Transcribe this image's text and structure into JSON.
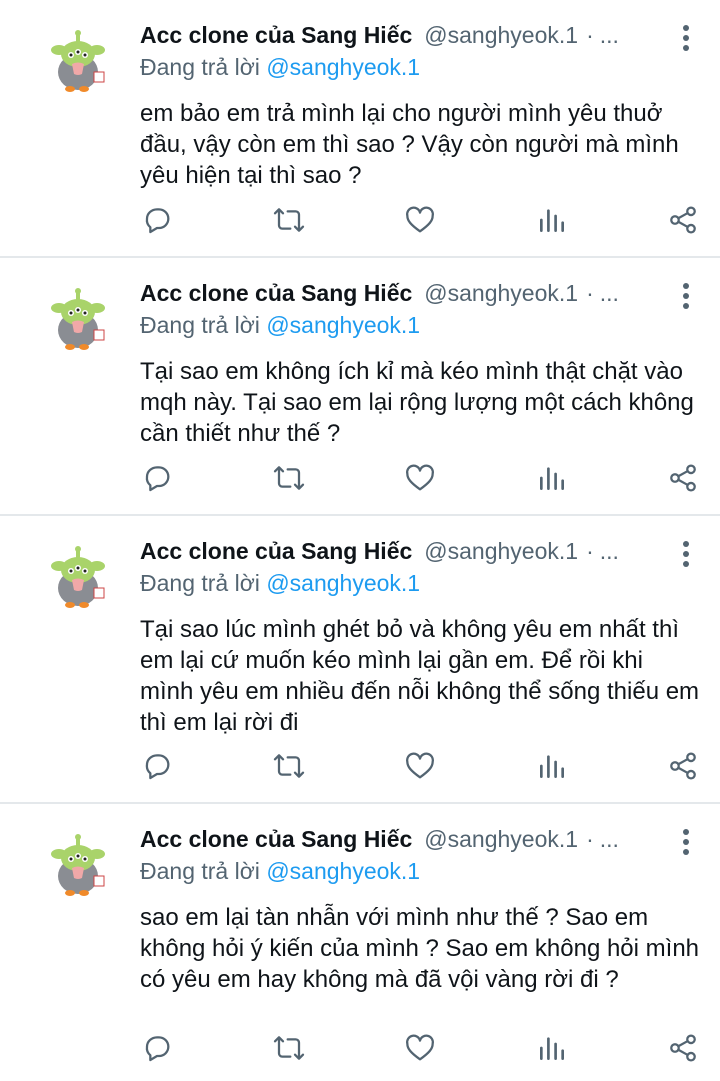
{
  "tweets": [
    {
      "author_name": "Acc clone của Sang Hiếc",
      "handle": "@sanghyeok.1",
      "sep": "·",
      "truncation": "...",
      "reply_prefix": "Đang trả lời ",
      "reply_mention": "@sanghyeok.1",
      "text": "em bảo em trả mình lại cho người mình yêu thuở đầu, vậy còn em thì sao ? Vậy còn người mà mình yêu hiện tại thì sao ?"
    },
    {
      "author_name": "Acc clone của Sang Hiếc",
      "handle": "@sanghyeok.1",
      "sep": "·",
      "truncation": "...",
      "reply_prefix": "Đang trả lời ",
      "reply_mention": "@sanghyeok.1",
      "text": "Tại sao em không ích kỉ mà kéo mình thật chặt vào mqh này. Tại sao em lại rộng lượng một cách không cần thiết như thế ?"
    },
    {
      "author_name": "Acc clone của Sang Hiếc",
      "handle": "@sanghyeok.1",
      "sep": "·",
      "truncation": "...",
      "reply_prefix": "Đang trả lời ",
      "reply_mention": "@sanghyeok.1",
      "text": "Tại sao lúc mình ghét bỏ và không yêu em nhất thì em lại cứ muốn kéo mình lại gần em. Để rồi khi mình yêu em nhiều đến nỗi không thể sống thiếu em thì em lại rời đi"
    },
    {
      "author_name": "Acc clone của Sang Hiếc",
      "handle": "@sanghyeok.1",
      "sep": "·",
      "truncation": "...",
      "reply_prefix": "Đang trả lời ",
      "reply_mention": "@sanghyeok.1",
      "text": "sao em lại tàn nhẫn với mình như thế ? Sao em không hỏi ý kiến của mình ? Sao em không hỏi mình có yêu em hay không mà đã vội vàng rời đi ?"
    }
  ],
  "icons": {
    "reply": "reply-icon",
    "retweet": "retweet-icon",
    "like": "like-icon",
    "views": "views-icon",
    "share": "share-icon",
    "more": "more-options-icon",
    "avatar": "green-alien-plush-avatar"
  },
  "colors": {
    "text": "#0f1419",
    "secondary": "#536471",
    "mention": "#1d9bf0",
    "divider": "#e4e8eb",
    "avatar_green": "#a9d36a"
  }
}
